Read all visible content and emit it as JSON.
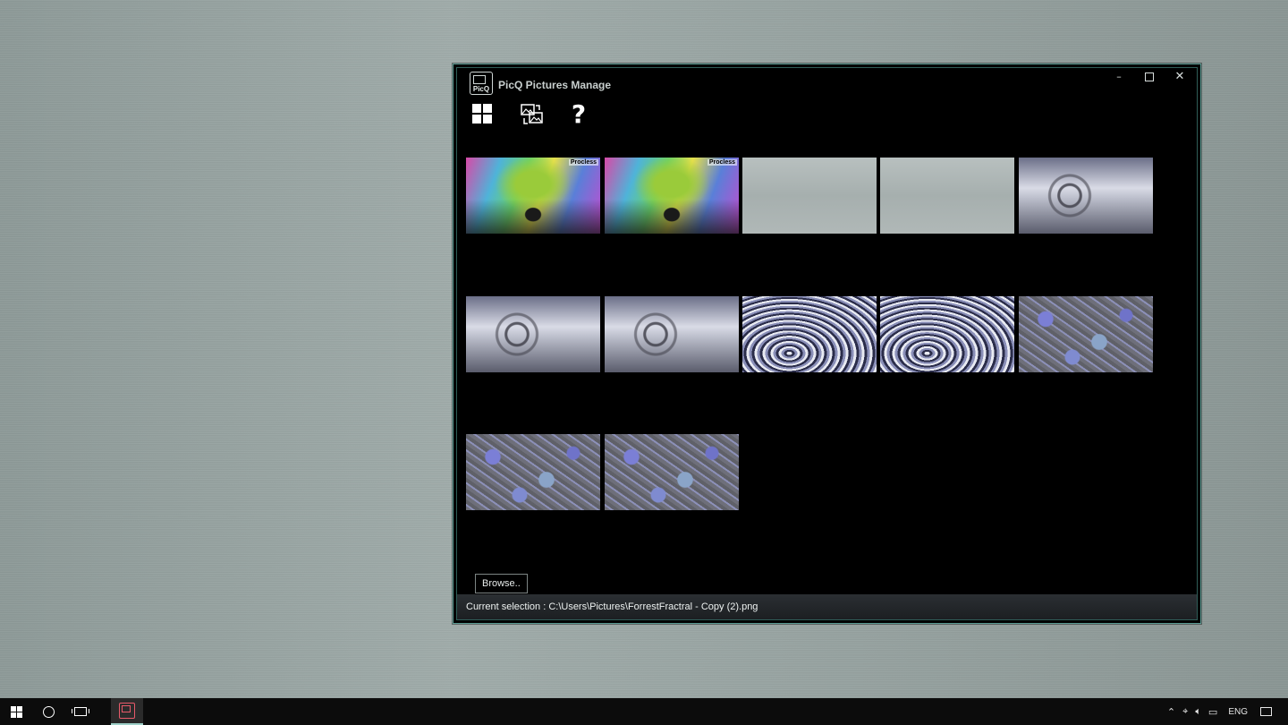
{
  "window": {
    "title": "PicQ Pictures Manage",
    "logo_text": "PicQ",
    "controls": {
      "minimize": "–",
      "close": "✕"
    }
  },
  "toolbar": {
    "grid_icon": "grid-view-icon",
    "swap_icon": "swap-pictures-icon",
    "help_label": "?"
  },
  "gallery": {
    "thumbnails": [
      {
        "kind": "tree",
        "label": "Procless"
      },
      {
        "kind": "tree",
        "label": "Procless"
      },
      {
        "kind": "gray",
        "label": ""
      },
      {
        "kind": "gray",
        "label": ""
      },
      {
        "kind": "bubble",
        "label": ""
      },
      {
        "kind": "bubble",
        "label": ""
      },
      {
        "kind": "bubble",
        "label": ""
      },
      {
        "kind": "rings",
        "label": ""
      },
      {
        "kind": "rings",
        "label": ""
      },
      {
        "kind": "fractal",
        "label": ""
      },
      {
        "kind": "fractal",
        "label": ""
      },
      {
        "kind": "fractal",
        "label": ""
      }
    ]
  },
  "footer": {
    "browse_label": "Browse..",
    "status_text": "Current selection : C:\\Users\\Pictures\\ForrestFractral - Copy (2).png"
  },
  "taskbar": {
    "language": "ENG",
    "tray_icons": [
      "chevron-up-icon",
      "network-icon",
      "volume-icon",
      "battery-icon"
    ],
    "accent": "#9ed0c8"
  }
}
